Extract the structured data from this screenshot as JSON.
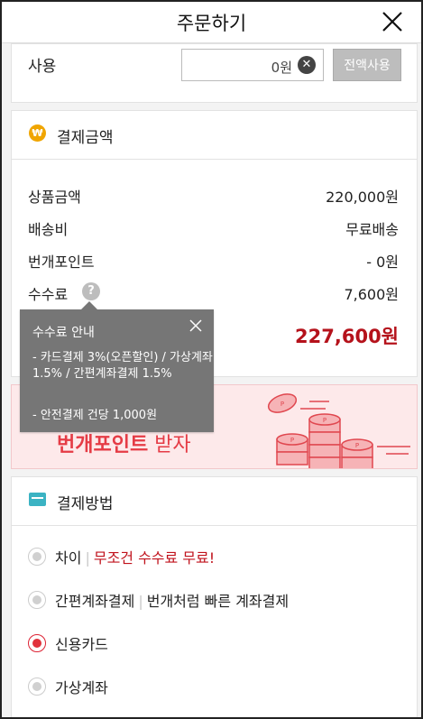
{
  "header": {
    "title": "주문하기"
  },
  "point_use": {
    "label": "사용",
    "input_value": "0원",
    "use_all_button": "전액사용"
  },
  "payment_amount": {
    "title": "결제금액",
    "rows": [
      {
        "label": "상품금액",
        "value": "220,000원"
      },
      {
        "label": "배송비",
        "value": "무료배송"
      },
      {
        "label": "번개포인트",
        "value": "- 0원"
      },
      {
        "label": "수수료",
        "value": "7,600원"
      }
    ],
    "total_value": "227,600원"
  },
  "fee_tooltip": {
    "title": "수수료 안내",
    "line1": "- 카드결제 3%(오픈할인) / 가상계좌 1.5% / 간편계좌결제 1.5%",
    "line2": "- 안전결제 건당 1,000원"
  },
  "banner": {
    "text_bold": "번개포인트",
    "text_light": " 받자"
  },
  "payment_method": {
    "title": "결제방법",
    "options": [
      {
        "name": "차이",
        "desc": "무조건 수수료 무료!",
        "selected": false
      },
      {
        "name": "간편계좌결제",
        "desc": "번개처럼 빠른 계좌결제",
        "selected": false
      },
      {
        "name": "신용카드",
        "desc": "",
        "selected": true
      },
      {
        "name": "가상계좌",
        "desc": "",
        "selected": false
      }
    ]
  },
  "colors": {
    "accent_red": "#c0121c",
    "tooltip_bg": "#767676",
    "banner_bg": "#fde9ea",
    "coin_icon": "#f0a500",
    "card_icon": "#3bb3c3"
  },
  "icons": {
    "close": "close-icon",
    "clear": "clear-icon",
    "coin": "won-coin-icon",
    "help": "question-icon",
    "card": "card-icon"
  }
}
